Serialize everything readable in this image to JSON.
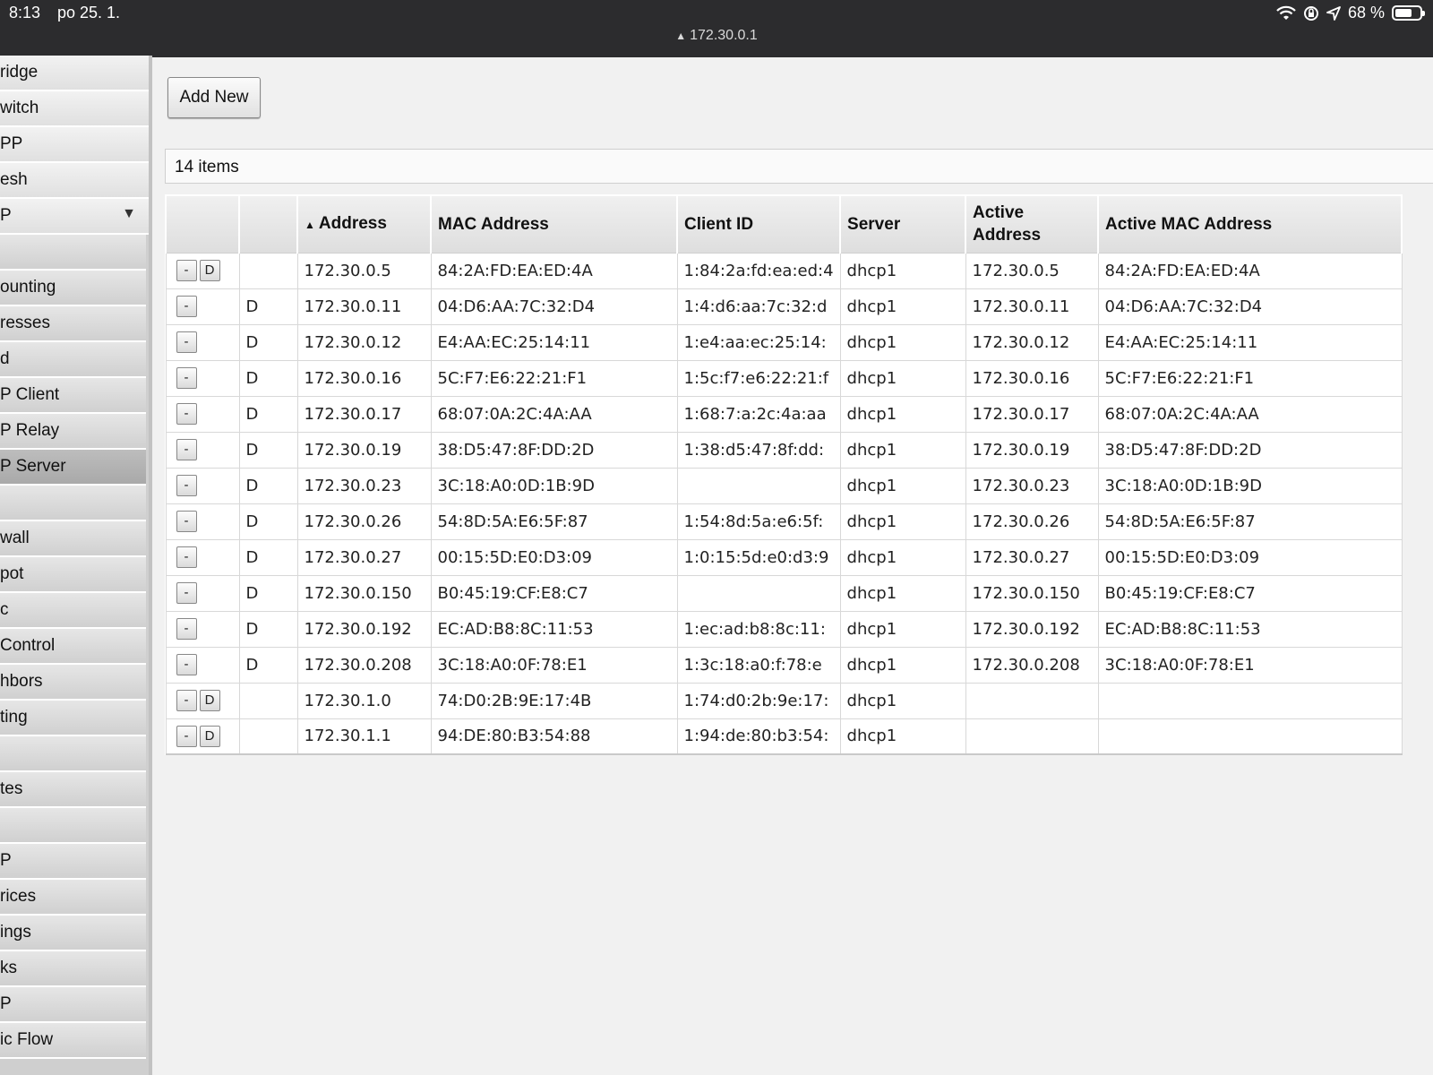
{
  "status_bar": {
    "time": "8:13",
    "date": "po 25. 1.",
    "battery": "68 %",
    "battery_level": 0.68,
    "url": "172.30.0.1",
    "url_icon": "warning-icon"
  },
  "sidebar": {
    "top_items": [
      "ridge",
      "witch",
      "PP",
      "esh",
      "P"
    ],
    "sub_items": [
      "",
      "ounting",
      "resses",
      "d",
      "P Client",
      "P Relay",
      "P Server",
      "",
      "wall",
      "pot",
      "c",
      "Control",
      "hbors",
      "ting",
      "",
      "tes",
      "",
      "P",
      "rices",
      "ings",
      "ks",
      "P",
      "ic Flow"
    ],
    "active_index": 6
  },
  "toolbar": {
    "add_new_label": "Add New"
  },
  "summary": {
    "items_text": "14 items"
  },
  "table": {
    "columns": [
      "",
      "",
      "Address",
      "MAC Address",
      "Client ID",
      "Server",
      "Active Address",
      "Active MAC Address"
    ],
    "rows": [
      {
        "btns": [
          "-",
          "D"
        ],
        "flag": "",
        "address": "172.30.0.5",
        "mac": "84:2A:FD:EA:ED:4A",
        "client_id": "1:84:2a:fd:ea:ed:4",
        "server": "dhcp1",
        "active_address": "172.30.0.5",
        "active_mac": "84:2A:FD:EA:ED:4A"
      },
      {
        "btns": [
          "-"
        ],
        "flag": "D",
        "address": "172.30.0.11",
        "mac": "04:D6:AA:7C:32:D4",
        "client_id": "1:4:d6:aa:7c:32:d",
        "server": "dhcp1",
        "active_address": "172.30.0.11",
        "active_mac": "04:D6:AA:7C:32:D4"
      },
      {
        "btns": [
          "-"
        ],
        "flag": "D",
        "address": "172.30.0.12",
        "mac": "E4:AA:EC:25:14:11",
        "client_id": "1:e4:aa:ec:25:14:",
        "server": "dhcp1",
        "active_address": "172.30.0.12",
        "active_mac": "E4:AA:EC:25:14:11"
      },
      {
        "btns": [
          "-"
        ],
        "flag": "D",
        "address": "172.30.0.16",
        "mac": "5C:F7:E6:22:21:F1",
        "client_id": "1:5c:f7:e6:22:21:f",
        "server": "dhcp1",
        "active_address": "172.30.0.16",
        "active_mac": "5C:F7:E6:22:21:F1"
      },
      {
        "btns": [
          "-"
        ],
        "flag": "D",
        "address": "172.30.0.17",
        "mac": "68:07:0A:2C:4A:AA",
        "client_id": "1:68:7:a:2c:4a:aa",
        "server": "dhcp1",
        "active_address": "172.30.0.17",
        "active_mac": "68:07:0A:2C:4A:AA"
      },
      {
        "btns": [
          "-"
        ],
        "flag": "D",
        "address": "172.30.0.19",
        "mac": "38:D5:47:8F:DD:2D",
        "client_id": "1:38:d5:47:8f:dd:",
        "server": "dhcp1",
        "active_address": "172.30.0.19",
        "active_mac": "38:D5:47:8F:DD:2D"
      },
      {
        "btns": [
          "-"
        ],
        "flag": "D",
        "address": "172.30.0.23",
        "mac": "3C:18:A0:0D:1B:9D",
        "client_id": "",
        "server": "dhcp1",
        "active_address": "172.30.0.23",
        "active_mac": "3C:18:A0:0D:1B:9D"
      },
      {
        "btns": [
          "-"
        ],
        "flag": "D",
        "address": "172.30.0.26",
        "mac": "54:8D:5A:E6:5F:87",
        "client_id": "1:54:8d:5a:e6:5f:",
        "server": "dhcp1",
        "active_address": "172.30.0.26",
        "active_mac": "54:8D:5A:E6:5F:87"
      },
      {
        "btns": [
          "-"
        ],
        "flag": "D",
        "address": "172.30.0.27",
        "mac": "00:15:5D:E0:D3:09",
        "client_id": "1:0:15:5d:e0:d3:9",
        "server": "dhcp1",
        "active_address": "172.30.0.27",
        "active_mac": "00:15:5D:E0:D3:09"
      },
      {
        "btns": [
          "-"
        ],
        "flag": "D",
        "address": "172.30.0.150",
        "mac": "B0:45:19:CF:E8:C7",
        "client_id": "",
        "server": "dhcp1",
        "active_address": "172.30.0.150",
        "active_mac": "B0:45:19:CF:E8:C7"
      },
      {
        "btns": [
          "-"
        ],
        "flag": "D",
        "address": "172.30.0.192",
        "mac": "EC:AD:B8:8C:11:53",
        "client_id": "1:ec:ad:b8:8c:11:",
        "server": "dhcp1",
        "active_address": "172.30.0.192",
        "active_mac": "EC:AD:B8:8C:11:53"
      },
      {
        "btns": [
          "-"
        ],
        "flag": "D",
        "address": "172.30.0.208",
        "mac": "3C:18:A0:0F:78:E1",
        "client_id": "1:3c:18:a0:f:78:e",
        "server": "dhcp1",
        "active_address": "172.30.0.208",
        "active_mac": "3C:18:A0:0F:78:E1"
      },
      {
        "btns": [
          "-",
          "D"
        ],
        "flag": "",
        "address": "172.30.1.0",
        "mac": "74:D0:2B:9E:17:4B",
        "client_id": "1:74:d0:2b:9e:17:",
        "server": "dhcp1",
        "active_address": "",
        "active_mac": ""
      },
      {
        "btns": [
          "-",
          "D"
        ],
        "flag": "",
        "address": "172.30.1.1",
        "mac": "94:DE:80:B3:54:88",
        "client_id": "1:94:de:80:b3:54:",
        "server": "dhcp1",
        "active_address": "",
        "active_mac": ""
      }
    ]
  }
}
